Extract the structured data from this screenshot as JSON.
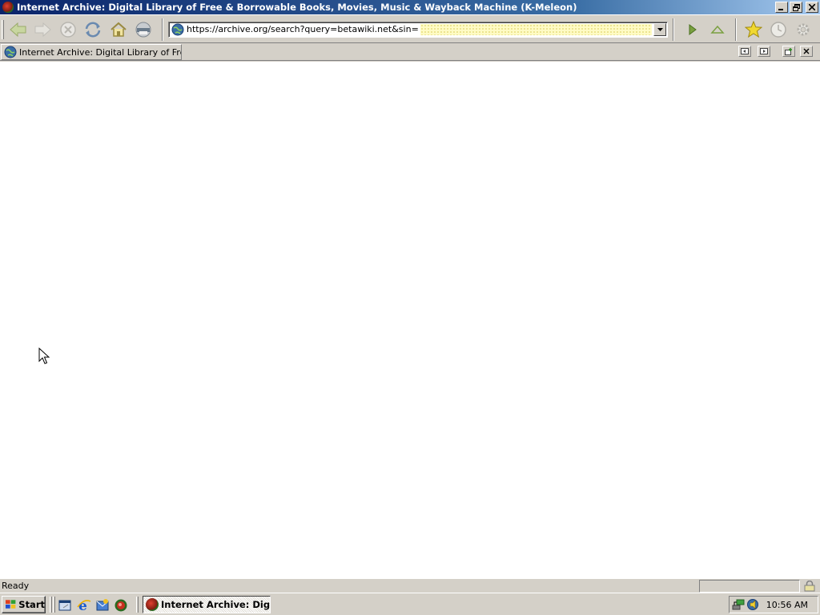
{
  "window": {
    "title": "Internet Archive: Digital Library of Free & Borrowable Books, Movies, Music & Wayback Machine (K-Meleon)"
  },
  "toolbar": {
    "url": "https://archive.org/search?query=betawiki.net&sin=",
    "icons": [
      "back-icon",
      "forward-icon",
      "stop-icon",
      "reload-icon",
      "home-icon",
      "print-icon",
      "go-icon",
      "up-icon",
      "bookmarks-icon",
      "history-icon",
      "preferences-icon"
    ]
  },
  "tabs": [
    {
      "label": "Internet Archive: Digital Library of Free…"
    }
  ],
  "statusbar": {
    "text": "Ready"
  },
  "taskbar": {
    "start_label": "Start",
    "quick_launch": [
      "show-desktop-icon",
      "internet-explorer-icon",
      "outlook-icon",
      "kmeleon-icon"
    ],
    "task_label": "Internet Archive: Digit...",
    "clock": "10:56 AM",
    "tray_icons": [
      "network-icon",
      "volume-icon"
    ]
  },
  "colors": {
    "titlebar_start": "#0a246a",
    "titlebar_end": "#a6caf0",
    "chrome": "#d4d0c8",
    "autofill": "#fffbc4"
  }
}
